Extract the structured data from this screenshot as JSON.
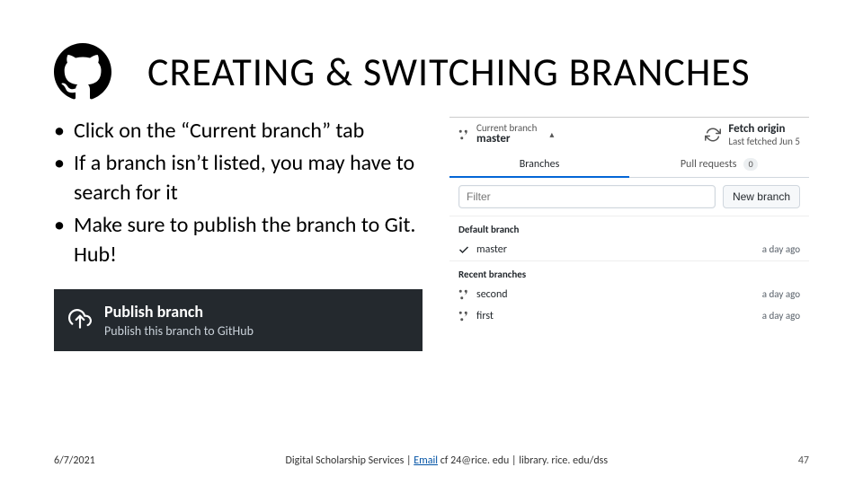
{
  "header": {
    "title": "CREATING & SWITCHING BRANCHES",
    "logo_icon": "github-icon"
  },
  "bullets": [
    "Click on the “Current branch” tab",
    "If a branch isn’t listed, you may have to search for it",
    "Make sure to publish the branch to Git. Hub!"
  ],
  "panel": {
    "current_branch": {
      "label": "Current branch",
      "name": "master",
      "caret": "▴"
    },
    "fetch": {
      "title": "Fetch origin",
      "subtitle": "Last fetched Jun 5"
    },
    "tabs": {
      "branches_label": "Branches",
      "pull_requests_label": "Pull requests",
      "pr_count": "0"
    },
    "filter": {
      "placeholder": "Filter",
      "new_branch_label": "New branch"
    },
    "default_section_label": "Default branch",
    "default_branch": {
      "name": "master",
      "when": "a day ago"
    },
    "recent_section_label": "Recent branches",
    "recent_branches": [
      {
        "name": "second",
        "when": "a day ago"
      },
      {
        "name": "first",
        "when": "a day ago"
      }
    ]
  },
  "publish": {
    "title": "Publish branch",
    "subtitle": "Publish this branch to GitHub"
  },
  "footer": {
    "date": "6/7/2021",
    "middle_pre": "Digital Scholarship Services | ",
    "email_label": "Email",
    "middle_post": " cf 24@rice. edu | library. rice. edu/dss",
    "page": "47"
  }
}
